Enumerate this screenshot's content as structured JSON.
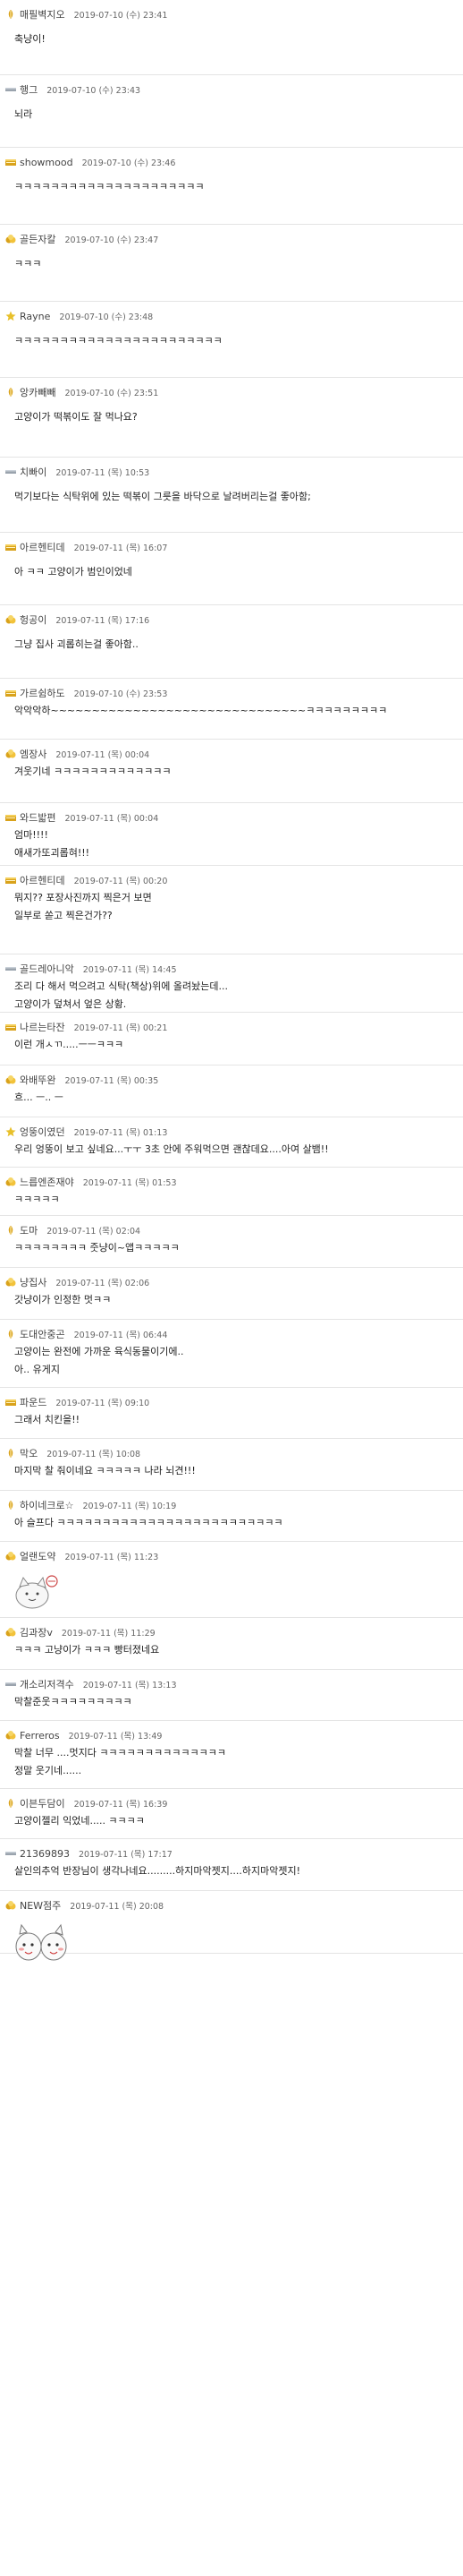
{
  "colors": {
    "text": "#222222",
    "meta": "#666666",
    "divider": "#e4e4e4",
    "gold": "#d9a21b",
    "silver": "#9aa3ad",
    "diamond": "#e8c02a"
  },
  "comments": [
    {
      "nick": "매필벽지오",
      "date": "2019-07-10 (수) 23:41",
      "badge": "leaf-badge-icon",
      "lines": [
        "축냥이!"
      ],
      "height": 78
    },
    {
      "nick": "행그",
      "date": "2019-07-10 (수) 23:43",
      "badge": "bar-badge-icon",
      "lines": [
        "뇌라"
      ],
      "height": 75
    },
    {
      "nick": "showmood",
      "date": "2019-07-10 (수) 23:46",
      "badge": "crown-badge-icon",
      "lines": [
        "ㅋㅋㅋㅋㅋㅋㅋㅋㅋㅋㅋㅋㅋㅋㅋㅋㅋㅋㅋㅋㅋ"
      ],
      "height": 80
    },
    {
      "nick": "골든자칼",
      "date": "2019-07-10 (수) 23:47",
      "badge": "coins-badge-icon",
      "lines": [
        "ㅋㅋㅋ"
      ],
      "height": 80
    },
    {
      "nick": "Rayne",
      "date": "2019-07-10 (수) 23:48",
      "badge": "star-badge-icon",
      "lines": [
        "ㅋㅋㅋㅋㅋㅋㅋㅋㅋㅋㅋㅋㅋㅋㅋㅋㅋㅋㅋㅋㅋㅋㅋ"
      ],
      "height": 79
    },
    {
      "nick": "앙카빼빼",
      "date": "2019-07-10 (수) 23:51",
      "badge": "leaf-badge-icon",
      "lines": [
        "고양이가 떡볶이도 잘 먹나요?"
      ],
      "height": 83
    },
    {
      "nick": "치빠이",
      "date": "2019-07-11 (목) 10:53",
      "badge": "bar-badge-icon",
      "lines": [
        "먹기보다는 식탁위에 있는 떡볶이 그릇을 바닥으로 날려버리는걸 좋아함;"
      ],
      "height": 78
    },
    {
      "nick": "아르헨티데",
      "date": "2019-07-11 (목) 16:07",
      "badge": "crown-badge-icon",
      "lines": [
        "아 ㅋㅋ 고양이가 범인이었네"
      ],
      "height": 75
    },
    {
      "nick": "헝공이",
      "date": "2019-07-11 (목) 17:16",
      "badge": "coins-badge-icon",
      "lines": [
        "그냥 집사 괴롭히는걸 좋아함.."
      ],
      "height": 76
    },
    {
      "nick": "가르쉼하도",
      "date": "2019-07-10 (수) 23:53",
      "badge": "crown-badge-icon",
      "lines": [
        "악악악하~~~~~~~~~~~~~~~~~~~~~~~~~~~~~~~ㅋㅋㅋㅋㅋㅋㅋㅋㅋ"
      ],
      "height": 62
    },
    {
      "nick": "엠장사",
      "date": "2019-07-11 (목) 00:04",
      "badge": "coins-badge-icon",
      "lines": [
        "겨웃기네 ㅋㅋㅋㅋㅋㅋㅋㅋㅋㅋㅋㅋㅋ"
      ],
      "height": 65
    },
    {
      "nick": "와드밟편",
      "date": "2019-07-11 (목) 00:04",
      "badge": "crown-badge-icon",
      "lines": [
        "엄마!!!!",
        "애새가또괴롭혀!!!"
      ],
      "height": 64
    },
    {
      "nick": "아르헨티데",
      "date": "2019-07-11 (목) 00:20",
      "badge": "crown-badge-icon",
      "lines": [
        "뭐지?? 포장사진까지 찍은거 보면",
        "일부로 쏟고 찍은건가??"
      ],
      "height": 93
    },
    {
      "nick": "골드레아니악",
      "date": "2019-07-11 (목) 14:45",
      "badge": "bar-badge-icon",
      "lines": [
        "조리 다 해서 먹으려고 식탁(책상)위에 올려놨는데...",
        "고양이가 덮쳐서 엎은 상황."
      ],
      "height": 59
    },
    {
      "nick": "나르는타잔",
      "date": "2019-07-11 (목) 00:21",
      "badge": "crown-badge-icon",
      "lines": [
        "이런 개ㅅㄲ.....ㅡㅡㅋㅋㅋ"
      ],
      "height": 53
    },
    {
      "nick": "와배뚜완",
      "date": "2019-07-11 (목) 00:35",
      "badge": "coins-badge-icon",
      "lines": [
        "흐...    ㅡ.. ㅡ"
      ],
      "height": 52
    },
    {
      "nick": "엉뚱이였던",
      "date": "2019-07-11 (목) 01:13",
      "badge": "star-badge-icon",
      "lines": [
        "우리 엉뚱이 보고 싶네요...ㅜㅜ 3초 안에 주워먹으면 괜찮데요....아여 살뱀!!"
      ],
      "height": 50
    },
    {
      "nick": "느릅엔존재야",
      "date": "2019-07-11 (목) 01:53",
      "badge": "coins-badge-icon",
      "lines": [
        "ㅋㅋㅋㅋㅋ"
      ],
      "height": 48
    },
    {
      "nick": "도마",
      "date": "2019-07-11 (목) 02:04",
      "badge": "leaf-badge-icon",
      "lines": [
        "ㅋㅋㅋㅋㅋㅋㅋㅋ 줏냥이~앱ㅋㅋㅋㅋㅋ"
      ],
      "height": 52
    },
    {
      "nick": "냥집사",
      "date": "2019-07-11 (목) 02:06",
      "badge": "coins-badge-icon",
      "lines": [
        "갓냥이가 인정한 멋ㅋㅋ"
      ],
      "height": 52
    },
    {
      "nick": "도대안중곤",
      "date": "2019-07-11 (목) 06:44",
      "badge": "leaf-badge-icon",
      "lines": [
        "고양이는 완전에 가까운 육식동물이기에..",
        "아.. 유게지"
      ],
      "height": 70
    },
    {
      "nick": "파운드",
      "date": "2019-07-11 (목) 09:10",
      "badge": "crown-badge-icon",
      "lines": [
        "그래서 치킨을!!"
      ],
      "height": 51
    },
    {
      "nick": "막오",
      "date": "2019-07-11 (목) 10:08",
      "badge": "leaf-badge-icon",
      "lines": [
        "마지막 찰 줘이네요 ㅋㅋㅋㅋㅋ 나라 뇌견!!!"
      ],
      "height": 52
    },
    {
      "nick": "하이네크로☆",
      "date": "2019-07-11 (목) 10:19",
      "badge": "leaf-badge-icon",
      "lines": [
        "아 슬프다 ㅋㅋㅋㅋㅋㅋㅋㅋㅋㅋㅋㅋㅋㅋㅋㅋㅋㅋㅋㅋㅋㅋㅋㅋㅋ"
      ],
      "height": 51
    },
    {
      "nick": "얼랜도약",
      "date": "2019-07-11 (목) 11:23",
      "badge": "coins-badge-icon",
      "lines": [],
      "emoticon": "cat-emoticon-icon",
      "height": 79
    },
    {
      "nick": "김과장v",
      "date": "2019-07-11 (목) 11:29",
      "badge": "coins-badge-icon",
      "lines": [
        "ㅋㅋㅋ 고냥이가 ㅋㅋㅋ 빵터졌네요"
      ],
      "height": 52
    },
    {
      "nick": "개소리저격수",
      "date": "2019-07-11 (목) 13:13",
      "badge": "bar-badge-icon",
      "lines": [
        "막찰준웃ㅋㅋㅋㅋㅋㅋㅋㅋㅋ"
      ],
      "height": 51
    },
    {
      "nick": "Ferreros",
      "date": "2019-07-11 (목) 13:49",
      "badge": "coins-badge-icon",
      "lines": [
        "막찰 너무 ....멋지다 ㅋㅋㅋㅋㅋㅋㅋㅋㅋㅋㅋㅋㅋㅋ",
        "정말 웃기네......"
      ],
      "height": 70
    },
    {
      "nick": "이븐두담이",
      "date": "2019-07-11 (목) 16:39",
      "badge": "leaf-badge-icon",
      "lines": [
        "고양이젤리 익었네..... ㅋㅋㅋㅋ"
      ],
      "height": 50
    },
    {
      "nick": "21369893",
      "date": "2019-07-11 (목) 17:17",
      "badge": "bar-badge-icon",
      "lines": [
        "살인의추억 반장님이 생각나네요.........하지마악젯지....하지마악젯지!"
      ],
      "height": 52
    },
    {
      "nick": "NEW점주",
      "date": "2019-07-11 (목) 20:08",
      "badge": "coins-badge-icon",
      "lines": [],
      "emoticon": "duo-emoticon-icon",
      "height": 64
    }
  ]
}
